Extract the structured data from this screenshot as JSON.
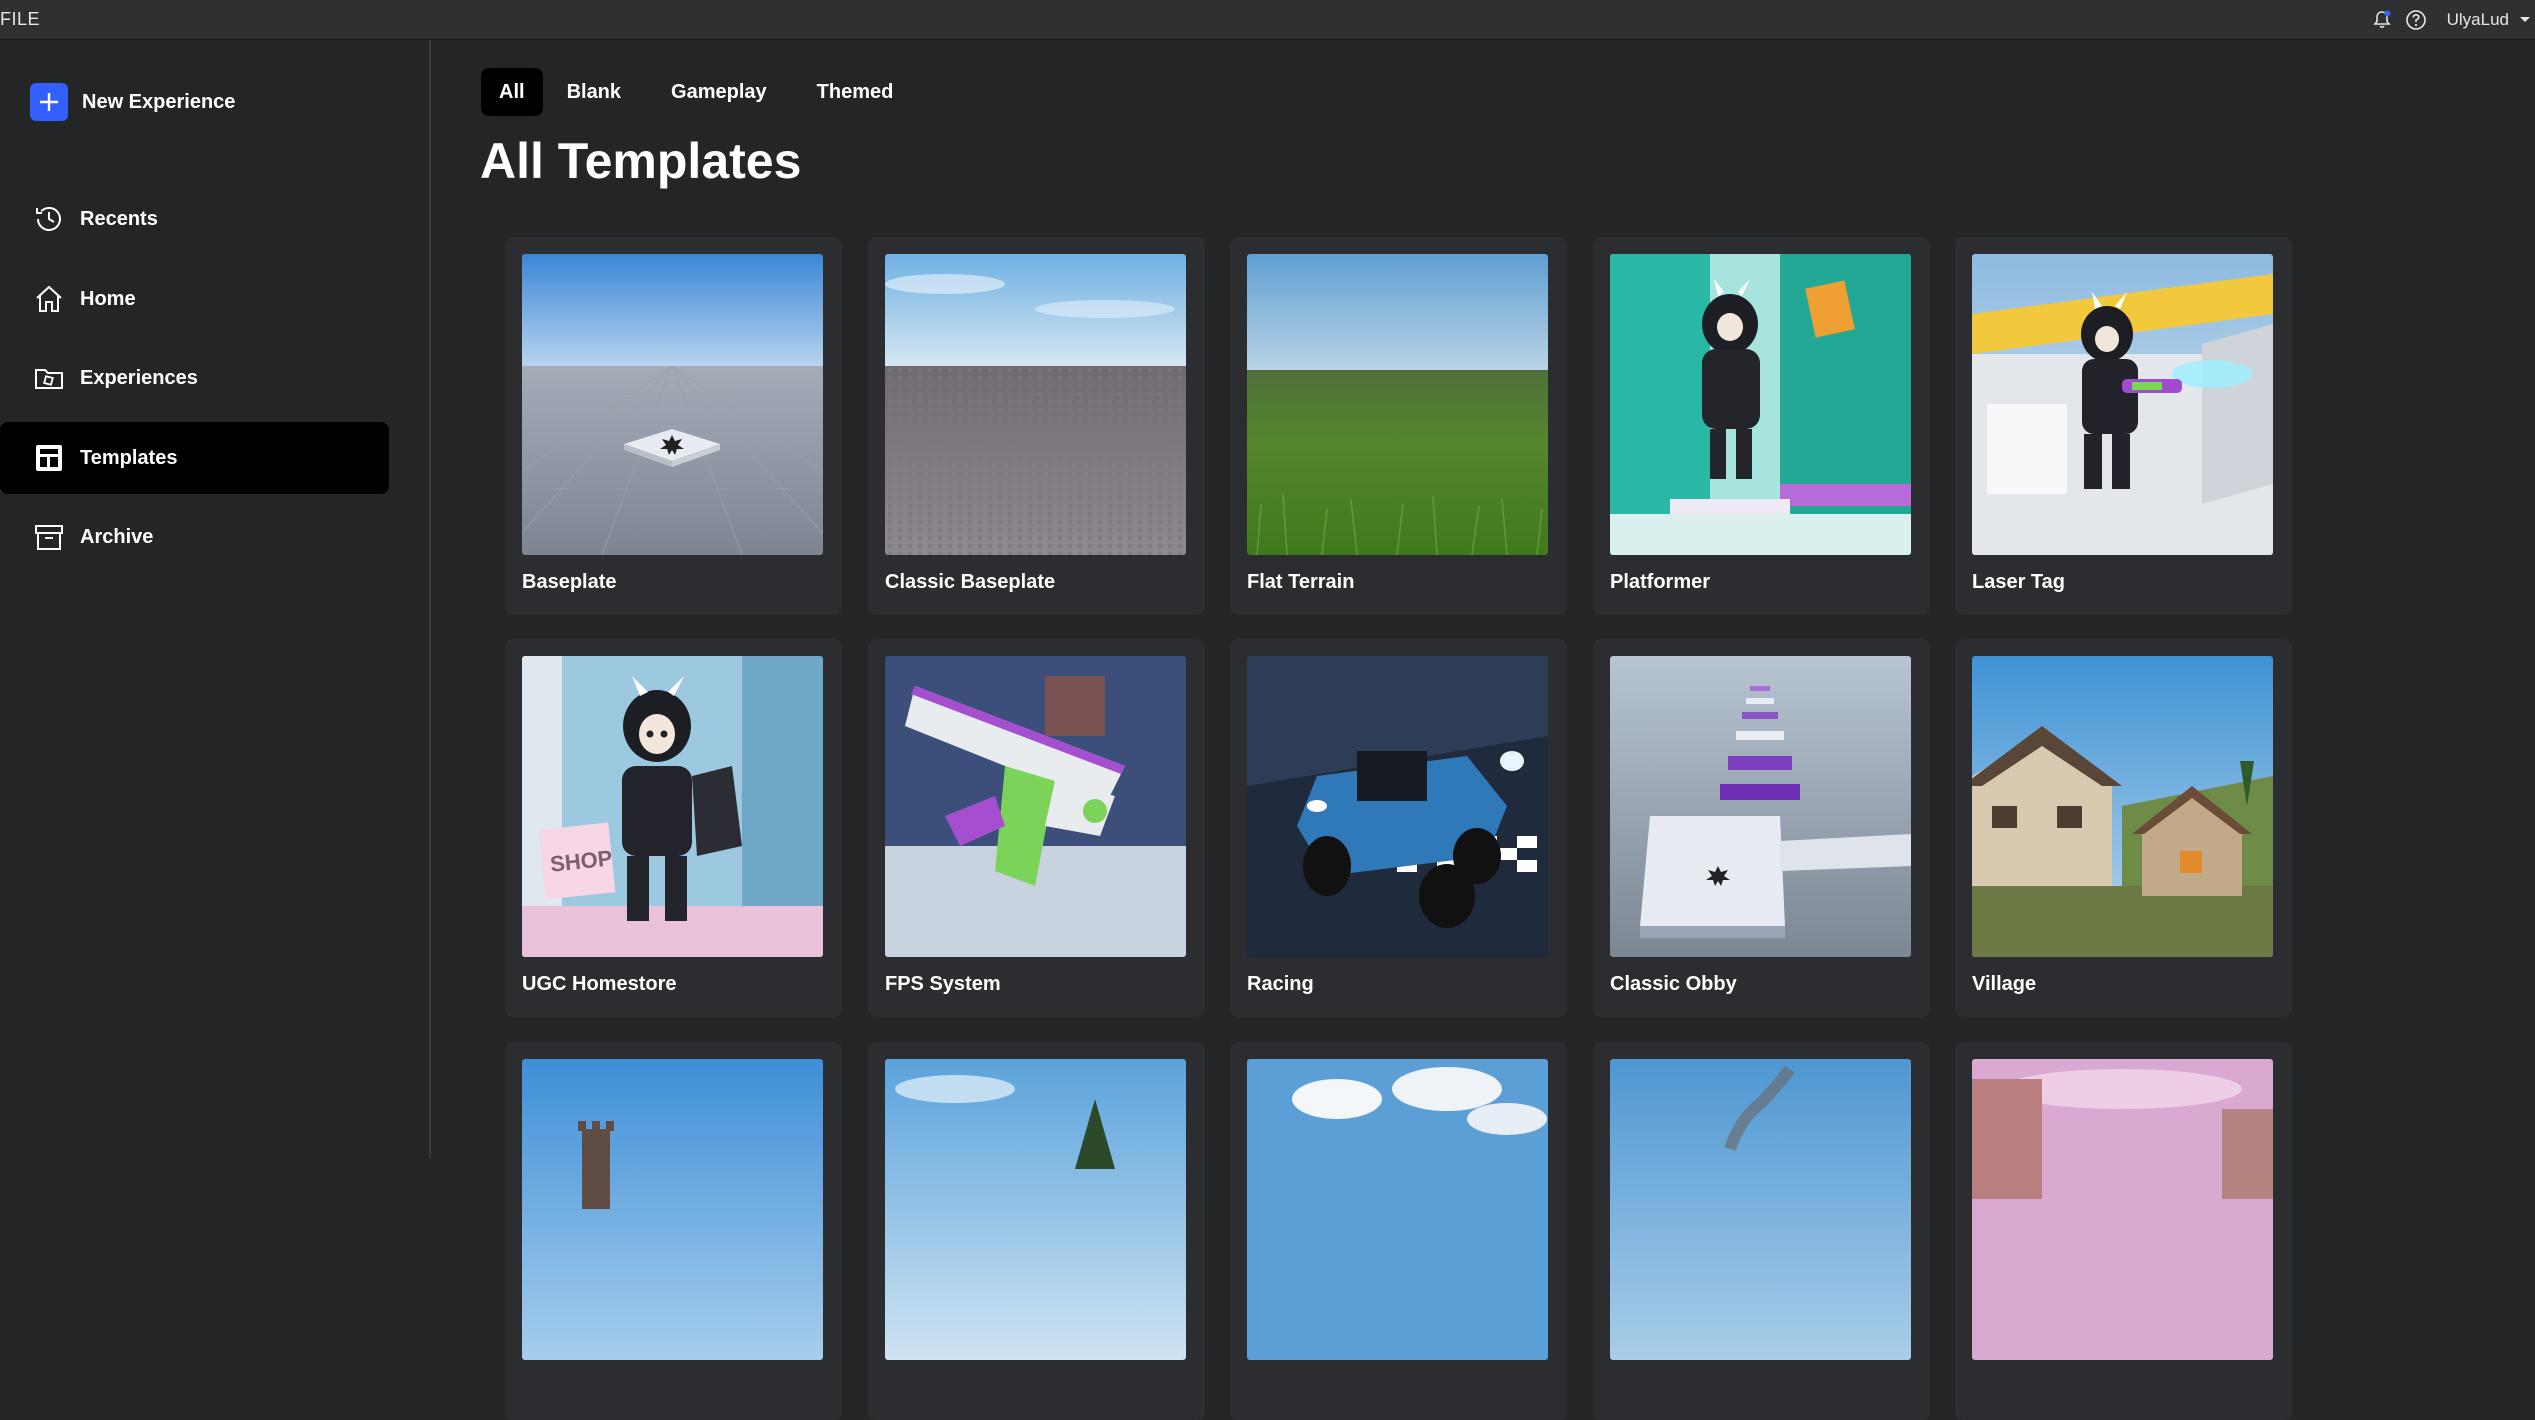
{
  "topbar": {
    "file_menu": "FILE",
    "username": "UlyaLud"
  },
  "sidebar": {
    "new_experience": "New Experience",
    "items": [
      {
        "label": "Recents"
      },
      {
        "label": "Home"
      },
      {
        "label": "Experiences"
      },
      {
        "label": "Templates",
        "active": true
      },
      {
        "label": "Archive"
      }
    ]
  },
  "filters": {
    "tabs": [
      {
        "label": "All",
        "active": true
      },
      {
        "label": "Blank"
      },
      {
        "label": "Gameplay"
      },
      {
        "label": "Themed"
      }
    ]
  },
  "page": {
    "title": "All Templates"
  },
  "templates": [
    {
      "title": "Baseplate",
      "thumb": "baseplate"
    },
    {
      "title": "Classic Baseplate",
      "thumb": "classic-baseplate"
    },
    {
      "title": "Flat Terrain",
      "thumb": "flat-terrain"
    },
    {
      "title": "Platformer",
      "thumb": "platformer"
    },
    {
      "title": "Laser Tag",
      "thumb": "laser-tag"
    },
    {
      "title": "UGC Homestore",
      "thumb": "ugc-homestore"
    },
    {
      "title": "FPS System",
      "thumb": "fps-system"
    },
    {
      "title": "Racing",
      "thumb": "racing"
    },
    {
      "title": "Classic Obby",
      "thumb": "classic-obby"
    },
    {
      "title": "Village",
      "thumb": "village"
    },
    {
      "title": "",
      "thumb": "castle"
    },
    {
      "title": "",
      "thumb": "forest"
    },
    {
      "title": "",
      "thumb": "sky-clouds"
    },
    {
      "title": "",
      "thumb": "smoke-sky"
    },
    {
      "title": "",
      "thumb": "pink-city"
    }
  ],
  "colors": {
    "accent": "#335fff",
    "background": "#232527",
    "card": "#2b2d30",
    "active_tab": "#000000",
    "notification_dot": "#335fff"
  }
}
